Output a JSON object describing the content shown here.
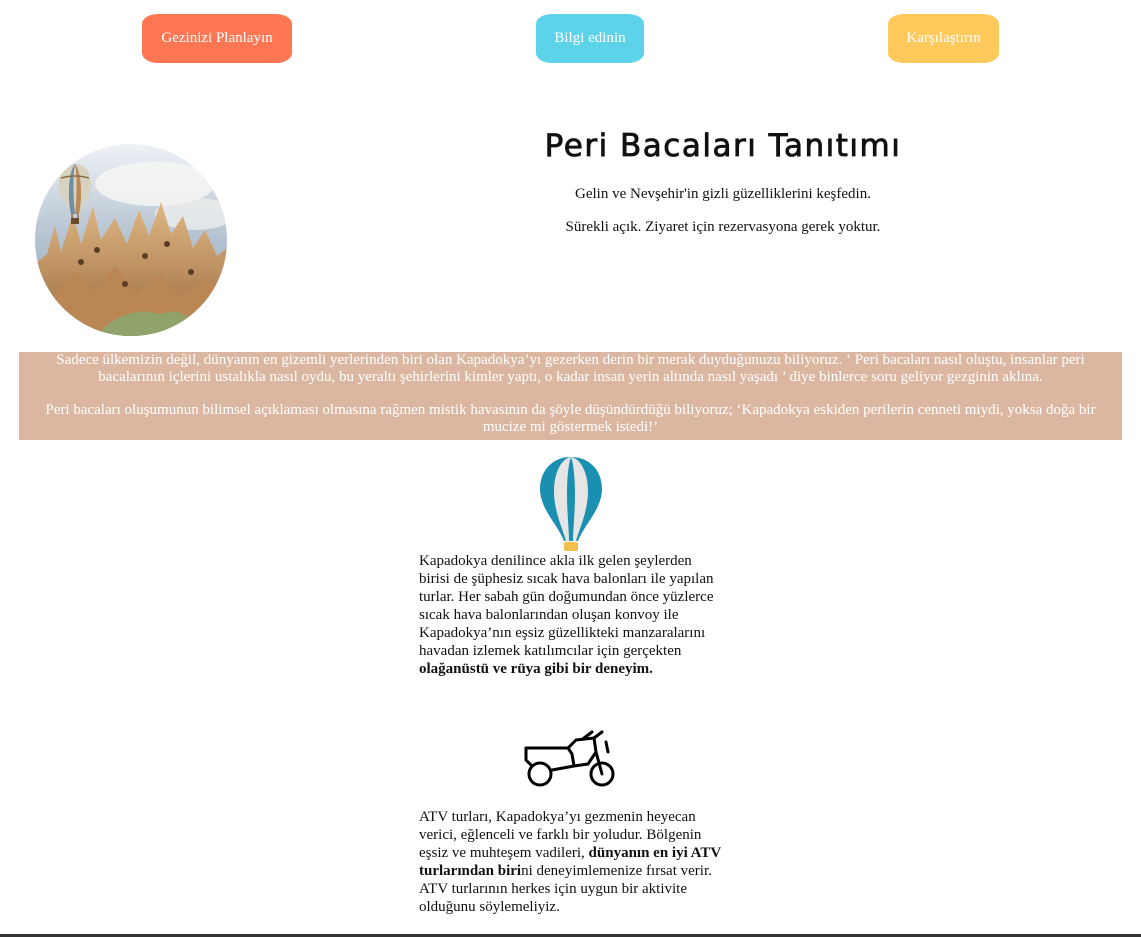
{
  "nav": {
    "plan_label": "Gezinizi Planlayın",
    "info_label": "Bilgi edinin",
    "compare_label": "Karşılaştırın",
    "colors": {
      "plan": "#ff7752",
      "info": "#5dd3ea",
      "compare": "#ffc95c"
    }
  },
  "hero": {
    "image": "cappadocia-fairy-chimneys-balloon",
    "title": "Peri Bacaları Tanıtımı",
    "subtitle1": "Gelin ve Nevşehir'in gizli güzelliklerini keşfedin.",
    "subtitle2": "Sürekli açık. Ziyaret için rezervasyona gerek yoktur."
  },
  "band": {
    "color": "#dbb7a2",
    "p1": "Sadece ülkemizin değil, dünyanın en gizemli yerlerinden biri olan Kapadokya’yı gezerken derin bir merak duyduğunuzu biliyoruz. ‘ Peri bacaları nasıl oluştu, insanlar peri bacalarının içlerini ustalıkla nasıl oydu, bu yeraltı şehirlerini kimler yaptı, o kadar insan yerin altında nasıl yaşadı ’ diye binlerce soru geliyor gezginin aklına.",
    "p2": "Peri bacaları oluşumunun bilimsel açıklaması olmasına rağmen mistik havasının da şöyle düşündürdüğü biliyoruz; ‘Kapadokya eskiden perilerin cenneti miydi, yoksa doğa bir mucize mi göstermek istedi!’"
  },
  "section1": {
    "icon": "hot-air-balloon-icon",
    "text": "Kapadokya denilince akla ilk gelen şeylerden birisi de şüphesiz sıcak hava balonları ile yapılan turlar. Her sabah gün doğumundan önce yüzlerce sıcak hava balonlarından oluşan konvoy ile Kapadokya’nın eşsiz güzellikteki manzaralarını havadan izlemek katılımcılar için gerçekten ",
    "bold": "olağanüstü ve rüya gibi bir deneyim."
  },
  "section2": {
    "icon": "atv-motorcycle-icon",
    "text_before": "ATV turları, Kapadokya’yı gezmenin heyecan verici, eğlenceli ve farklı bir yoludur. Bölgenin eşsiz ve muhteşem vadileri, ",
    "bold": "dünyanın en iyi ATV turlarından biri",
    "text_after": "ni deneyimlemenize fırsat verir. ATV turlarının herkes için uygun bir aktivite olduğunu söylemeliyiz."
  }
}
